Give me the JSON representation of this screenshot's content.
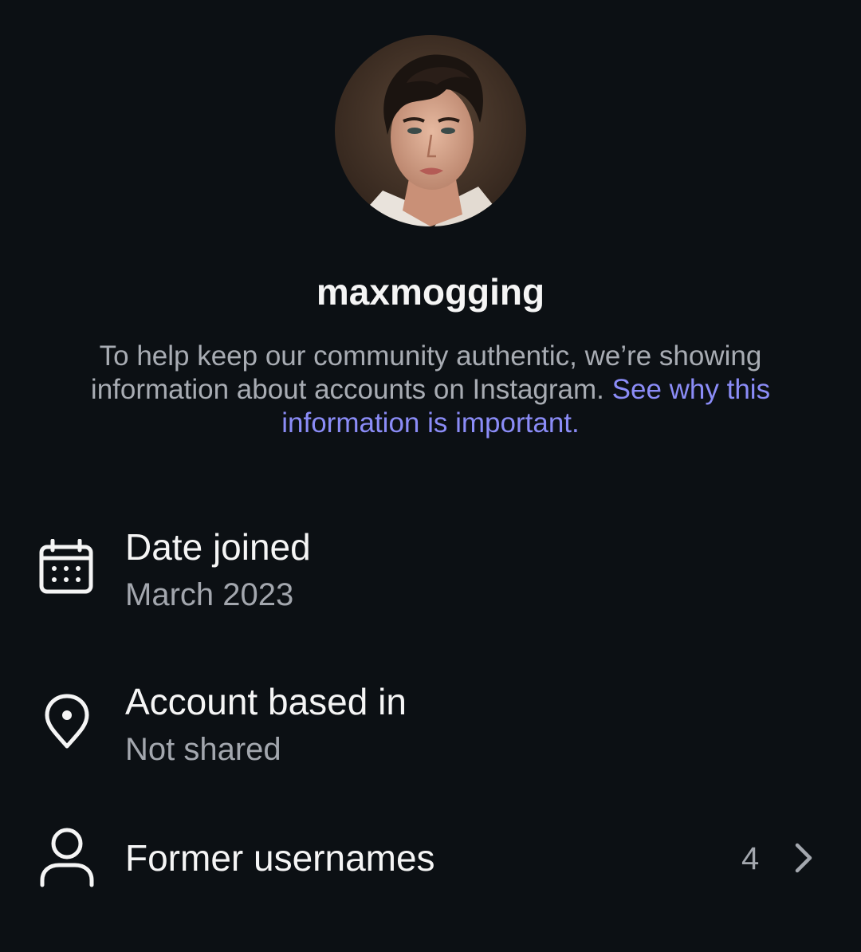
{
  "profile": {
    "username": "maxmogging",
    "avatar_alt": "profile photo"
  },
  "description": {
    "text": "To help keep our community authentic, we’re showing information about accounts on Instagram. ",
    "link": "See why this information is important."
  },
  "rows": {
    "date_joined": {
      "icon": "calendar-icon",
      "title": "Date joined",
      "value": "March 2023"
    },
    "account_based_in": {
      "icon": "location-pin-icon",
      "title": "Account based in",
      "value": "Not shared"
    },
    "former_usernames": {
      "icon": "person-icon",
      "title": "Former usernames",
      "count": "4",
      "chevron": "chevron-right-icon"
    }
  },
  "colors": {
    "background": "#0c1014",
    "link": "#8b8cf7",
    "primary_text": "#f5f5f5",
    "secondary_text": "#a3a7ae"
  }
}
